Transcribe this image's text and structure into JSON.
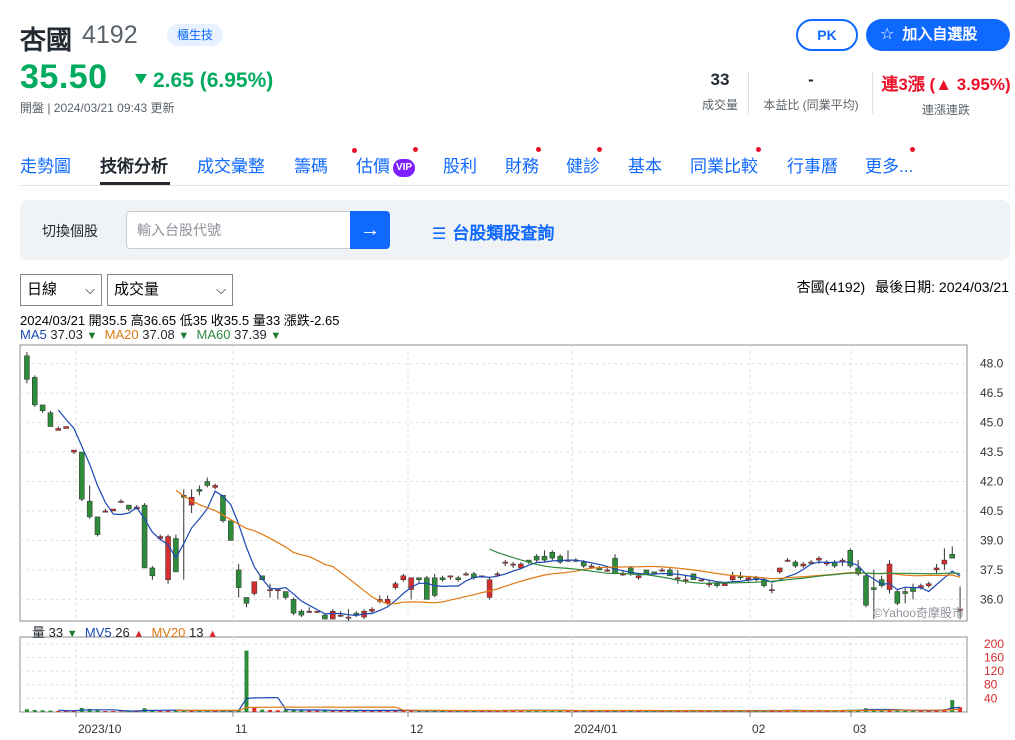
{
  "stock": {
    "name": "杏國",
    "code": "4192",
    "tag": "櫃生技",
    "price": "35.50",
    "change": "2.65 (6.95%)",
    "status": "開盤 | 2024/03/21 09:43 更新"
  },
  "actions": {
    "pk_label": "PK",
    "watchlist_label": "加入自選股"
  },
  "stats": {
    "volume": {
      "value": "33",
      "label": "成交量"
    },
    "pe": {
      "value": "-",
      "label": "本益比 (同業平均)"
    },
    "streak": {
      "value": "連3漲 (▲ 3.95%)",
      "label": "連漲連跌"
    }
  },
  "tabs": [
    {
      "label": "走勢圖",
      "dot": false
    },
    {
      "label": "技術分析",
      "dot": false,
      "active": true
    },
    {
      "label": "成交彙整",
      "dot": false
    },
    {
      "label": "籌碼",
      "dot": true
    },
    {
      "label": "估價",
      "dot": true,
      "vip": "VIP"
    },
    {
      "label": "股利",
      "dot": false
    },
    {
      "label": "財務",
      "dot": true
    },
    {
      "label": "健診",
      "dot": true
    },
    {
      "label": "基本",
      "dot": false
    },
    {
      "label": "同業比較",
      "dot": true
    },
    {
      "label": "行事曆",
      "dot": false
    },
    {
      "label": "更多...",
      "dot": true
    }
  ],
  "search": {
    "label": "切換個股",
    "placeholder": "輸入台股代號",
    "category_link": "台股類股查詢"
  },
  "chart_controls": {
    "period": "日線",
    "indicator": "成交量",
    "title": "杏國(4192)",
    "last_date": "最後日期: 2024/03/21"
  },
  "chart_data": {
    "type": "candlestick",
    "ohlc_line": "2024/03/21 開35.5 高36.65 低35 收35.5 量33 漲跌-2.65",
    "ma": [
      {
        "label": "MA5",
        "value": "37.03",
        "dir": "down"
      },
      {
        "label": "MA20",
        "value": "37.08",
        "dir": "down"
      },
      {
        "label": "MA60",
        "value": "37.39",
        "dir": "down"
      }
    ],
    "vol_legend": [
      {
        "label": "量",
        "value": "33",
        "dir": "down"
      },
      {
        "label": "MV5",
        "value": "26",
        "dir": "up"
      },
      {
        "label": "MV20",
        "value": "13",
        "dir": "up"
      }
    ],
    "price_ticks": [
      "48.0",
      "46.5",
      "45.0",
      "43.5",
      "42.0",
      "40.5",
      "39.0",
      "37.5",
      "36.0"
    ],
    "volume_ticks": [
      "200",
      "160",
      "120",
      "80",
      "40"
    ],
    "x_labels": [
      "2023/10",
      "11",
      "12",
      "2024/01",
      "02",
      "03"
    ],
    "watermark": "©Yahoo奇摩股市",
    "candles": [
      [
        48.4,
        48.6,
        47.0,
        47.2
      ],
      [
        47.3,
        47.4,
        45.8,
        45.9
      ],
      [
        45.9,
        45.9,
        45.5,
        45.6
      ],
      [
        45.5,
        45.6,
        44.8,
        44.8
      ],
      [
        44.6,
        44.8,
        44.6,
        44.7
      ],
      [
        44.7,
        44.8,
        44.7,
        44.8
      ],
      [
        43.5,
        43.6,
        43.4,
        43.6
      ],
      [
        43.5,
        43.5,
        41.0,
        41.1
      ],
      [
        41.0,
        41.8,
        40.1,
        40.2
      ],
      [
        40.2,
        40.2,
        39.2,
        39.3
      ],
      [
        40.5,
        40.6,
        40.5,
        40.5
      ],
      [
        40.5,
        40.6,
        40.5,
        40.6
      ],
      [
        41.0,
        41.1,
        40.9,
        41.0
      ],
      [
        40.8,
        40.8,
        40.5,
        40.6
      ],
      [
        40.6,
        40.8,
        40.6,
        40.7
      ],
      [
        40.8,
        40.9,
        37.6,
        37.6
      ],
      [
        37.6,
        37.7,
        37.0,
        37.2
      ],
      [
        39.1,
        39.3,
        39.0,
        39.2
      ],
      [
        37.0,
        39.3,
        36.8,
        39.2
      ],
      [
        39.1,
        39.3,
        37.4,
        37.4
      ],
      [
        41.3,
        41.6,
        37.0,
        41.2
      ],
      [
        40.8,
        41.6,
        40.4,
        41.2
      ],
      [
        41.6,
        41.8,
        41.3,
        41.5
      ],
      [
        42.0,
        42.2,
        41.7,
        41.8
      ],
      [
        41.7,
        41.9,
        41.6,
        41.8
      ],
      [
        41.3,
        41.3,
        39.9,
        40.0
      ],
      [
        40.0,
        40.0,
        39.0,
        39.0
      ],
      [
        37.5,
        37.8,
        36.1,
        36.6
      ],
      [
        36.1,
        36.1,
        35.6,
        35.8
      ],
      [
        36.3,
        36.9,
        36.2,
        36.9
      ],
      [
        37.2,
        37.2,
        37.0,
        37.0
      ],
      [
        36.5,
        36.8,
        36.1,
        36.5
      ],
      [
        36.5,
        36.5,
        36.0,
        36.5
      ],
      [
        36.4,
        36.4,
        36.0,
        36.1
      ],
      [
        36.0,
        36.1,
        35.2,
        35.3
      ],
      [
        35.4,
        35.5,
        35.1,
        35.2
      ],
      [
        35.4,
        35.6,
        35.3,
        35.4
      ],
      [
        35.4,
        35.4,
        35.3,
        35.4
      ],
      [
        35.2,
        35.3,
        35.0,
        35.0
      ],
      [
        35.0,
        35.5,
        35.0,
        35.4
      ],
      [
        35.2,
        35.4,
        35.1,
        35.2
      ],
      [
        35.1,
        35.5,
        34.9,
        35.1
      ],
      [
        35.3,
        35.4,
        35.1,
        35.2
      ],
      [
        35.1,
        35.5,
        35.0,
        35.4
      ],
      [
        35.4,
        35.6,
        35.3,
        35.5
      ],
      [
        35.9,
        36.2,
        35.8,
        36.0
      ],
      [
        35.8,
        36.2,
        35.7,
        36.0
      ],
      [
        36.6,
        36.9,
        36.5,
        36.8
      ],
      [
        37.0,
        37.3,
        36.9,
        37.2
      ],
      [
        36.5,
        37.1,
        36.0,
        37.1
      ],
      [
        37.1,
        37.1,
        36.8,
        37.0
      ],
      [
        37.1,
        37.2,
        36.0,
        36.0
      ],
      [
        37.1,
        37.3,
        36.1,
        36.2
      ],
      [
        37.1,
        37.2,
        36.9,
        37.0
      ],
      [
        37.2,
        37.2,
        37.0,
        37.2
      ],
      [
        37.1,
        37.2,
        36.9,
        37.0
      ],
      [
        37.3,
        37.4,
        37.2,
        37.3
      ],
      [
        37.3,
        37.4,
        37.0,
        37.1
      ],
      [
        37.2,
        37.2,
        37.1,
        37.2
      ],
      [
        36.1,
        37.1,
        36.0,
        37.0
      ],
      [
        37.3,
        37.4,
        37.2,
        37.3
      ],
      [
        37.9,
        38.0,
        37.7,
        37.9
      ],
      [
        37.8,
        37.9,
        37.6,
        37.8
      ],
      [
        37.6,
        37.9,
        37.6,
        37.8
      ],
      [
        38.0,
        38.0,
        37.8,
        37.9
      ],
      [
        38.2,
        38.3,
        37.9,
        38.0
      ],
      [
        38.2,
        38.5,
        37.9,
        38.0
      ],
      [
        38.4,
        38.5,
        38.0,
        38.1
      ],
      [
        38.2,
        38.3,
        37.8,
        37.9
      ],
      [
        38.0,
        38.5,
        37.9,
        38.0
      ],
      [
        38.0,
        38.1,
        37.9,
        38.0
      ],
      [
        37.9,
        38.0,
        37.6,
        37.7
      ],
      [
        37.7,
        37.8,
        37.6,
        37.7
      ],
      [
        37.6,
        37.7,
        37.5,
        37.5
      ],
      [
        37.5,
        37.6,
        37.4,
        37.5
      ],
      [
        38.1,
        38.3,
        37.3,
        37.3
      ],
      [
        37.3,
        37.5,
        37.2,
        37.3
      ],
      [
        37.6,
        37.7,
        37.2,
        37.3
      ],
      [
        37.1,
        37.3,
        37.0,
        37.2
      ],
      [
        37.5,
        37.5,
        37.3,
        37.3
      ],
      [
        37.4,
        37.4,
        37.3,
        37.3
      ],
      [
        37.5,
        37.6,
        37.4,
        37.5
      ],
      [
        37.5,
        37.6,
        37.2,
        37.2
      ],
      [
        37.1,
        37.5,
        36.8,
        37.1
      ],
      [
        37.0,
        37.2,
        36.8,
        37.0
      ],
      [
        37.3,
        37.3,
        37.0,
        37.0
      ],
      [
        37.0,
        37.0,
        36.9,
        37.0
      ],
      [
        36.8,
        37.0,
        36.6,
        36.8
      ],
      [
        36.8,
        36.8,
        36.6,
        36.7
      ],
      [
        36.7,
        36.8,
        36.7,
        36.8
      ],
      [
        37.0,
        37.4,
        36.9,
        37.2
      ],
      [
        37.2,
        37.4,
        37.0,
        37.1
      ],
      [
        37.0,
        37.2,
        36.9,
        37.1
      ],
      [
        37.1,
        37.2,
        36.9,
        37.0
      ],
      [
        37.0,
        37.1,
        36.6,
        36.7
      ],
      [
        36.5,
        36.8,
        36.3,
        36.5
      ],
      [
        37.4,
        37.6,
        37.3,
        37.6
      ],
      [
        38.0,
        38.1,
        37.9,
        38.0
      ],
      [
        37.9,
        38.0,
        37.6,
        37.7
      ],
      [
        37.7,
        37.9,
        37.6,
        37.8
      ],
      [
        37.9,
        38.0,
        37.8,
        37.9
      ],
      [
        38.0,
        38.2,
        37.8,
        38.1
      ],
      [
        37.8,
        38.0,
        37.7,
        37.9
      ],
      [
        37.9,
        38.0,
        37.6,
        37.7
      ],
      [
        37.9,
        38.1,
        37.7,
        38.0
      ],
      [
        38.5,
        38.6,
        37.6,
        37.7
      ],
      [
        37.6,
        38.0,
        37.2,
        37.3
      ],
      [
        37.2,
        37.3,
        35.6,
        35.7
      ],
      [
        36.6,
        37.5,
        35.0,
        36.5
      ],
      [
        37.0,
        37.2,
        36.6,
        36.7
      ],
      [
        36.5,
        38.0,
        36.3,
        37.8
      ],
      [
        36.4,
        36.5,
        35.7,
        35.8
      ],
      [
        36.4,
        36.6,
        35.8,
        36.3
      ],
      [
        36.6,
        36.8,
        36.0,
        36.4
      ],
      [
        36.6,
        36.8,
        36.5,
        36.7
      ],
      [
        36.7,
        36.9,
        36.6,
        36.8
      ],
      [
        37.5,
        37.8,
        37.3,
        37.6
      ],
      [
        37.8,
        38.6,
        37.5,
        38.0
      ],
      [
        38.3,
        38.7,
        38.1,
        38.1
      ],
      [
        35.5,
        36.65,
        35.0,
        35.5
      ]
    ],
    "volumes": [
      8,
      6,
      5,
      4,
      3,
      3,
      4,
      12,
      9,
      5,
      3,
      3,
      2,
      3,
      3,
      11,
      5,
      3,
      4,
      5,
      6,
      4,
      3,
      4,
      3,
      5,
      4,
      6,
      180,
      12,
      7,
      6,
      5,
      7,
      8,
      5,
      5,
      4,
      6,
      5,
      5,
      4,
      4,
      5,
      4,
      6,
      5,
      4,
      5,
      4,
      3,
      4,
      5,
      4,
      3,
      5,
      4,
      4,
      3,
      5,
      4,
      6,
      5,
      4,
      5,
      6,
      5,
      4,
      5,
      4,
      3,
      4,
      5,
      4,
      3,
      5,
      4,
      4,
      4,
      3,
      3,
      4,
      5,
      4,
      4,
      5,
      3,
      3,
      4,
      3,
      4,
      5,
      4,
      4,
      4,
      5,
      4,
      6,
      4,
      3,
      4,
      5,
      4,
      4,
      5,
      6,
      7,
      11,
      8,
      5,
      6,
      4,
      5,
      4,
      5,
      4,
      6,
      8,
      35,
      14
    ]
  }
}
